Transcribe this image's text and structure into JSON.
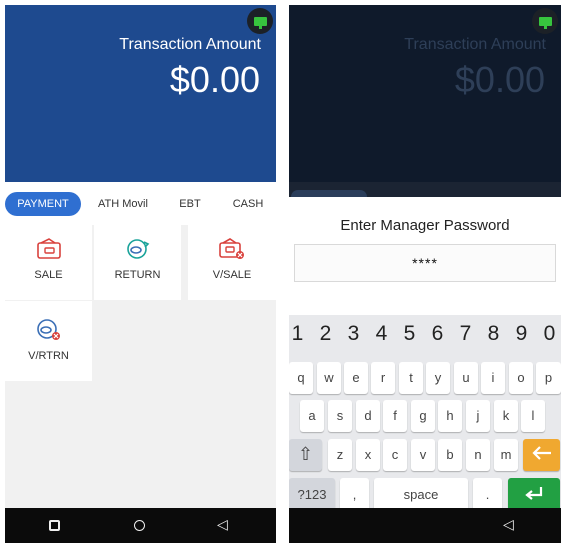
{
  "left_screen": {
    "header": {
      "amount_label": "Transaction Amount",
      "amount": "$0.00"
    },
    "tabs": [
      {
        "label": "PAYMENT",
        "active": true
      },
      {
        "label": "ATH Movil",
        "active": false
      },
      {
        "label": "EBT",
        "active": false
      },
      {
        "label": "CASH",
        "active": false
      }
    ],
    "actions": [
      {
        "label": "SALE",
        "icon": "wallet-icon"
      },
      {
        "label": "RETURN",
        "icon": "refund-coin-icon"
      },
      {
        "label": "V/SALE",
        "icon": "void-wallet-icon"
      },
      {
        "label": "V/RTRN",
        "icon": "void-return-icon"
      }
    ],
    "navbar": {
      "back": "◁",
      "home": "○",
      "recents": "□"
    }
  },
  "right_screen": {
    "header": {
      "amount_label": "Transaction Amount",
      "amount": "$0.00"
    },
    "dialog": {
      "title": "Enter Manager Password",
      "value": "****"
    },
    "keyboard": {
      "number_row": [
        "1",
        "2",
        "3",
        "4",
        "5",
        "6",
        "7",
        "8",
        "9",
        "0"
      ],
      "row1": [
        "q",
        "w",
        "e",
        "r",
        "t",
        "y",
        "u",
        "i",
        "o",
        "p"
      ],
      "row2": [
        "a",
        "s",
        "d",
        "f",
        "g",
        "h",
        "j",
        "k",
        "l"
      ],
      "row3": [
        "z",
        "x",
        "c",
        "v",
        "b",
        "n",
        "m"
      ],
      "mode_key": "?123",
      "comma_key": ",",
      "space_key": "space",
      "period_key": ".",
      "shift_icon": "⇧",
      "backspace_icon": "🡐",
      "enter_icon": "↵"
    },
    "navbar": {
      "back": "◁"
    }
  },
  "colors": {
    "header_blue": "#1e4a8f",
    "tab_active": "#2f6fd1",
    "icon_red": "#d9423d",
    "icon_blue": "#3b6fb6",
    "icon_teal": "#1aa39a",
    "status_green": "#37c43e",
    "backspace_orange": "#f0a830",
    "enter_green": "#22a043"
  }
}
